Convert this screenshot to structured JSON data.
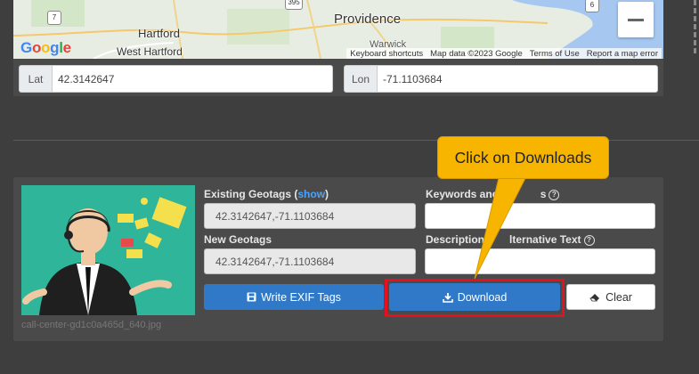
{
  "map": {
    "cities": {
      "providence": "Providence",
      "hartford": "Hartford",
      "west_hartford": "West Hartford",
      "warwick": "Warwick"
    },
    "highways": [
      "7",
      "395",
      "6"
    ],
    "google_logo": [
      "G",
      "o",
      "o",
      "g",
      "l",
      "e"
    ],
    "footer": {
      "keyboard": "Keyboard shortcuts",
      "data": "Map data ©2023 Google",
      "terms": "Terms of Use",
      "report": "Report a map error"
    },
    "zoom_out_icon": "minus-icon"
  },
  "coords": {
    "lat_label": "Lat",
    "lat_value": "42.3142647",
    "lon_label": "Lon",
    "lon_value": "-71.1103684"
  },
  "image": {
    "filename": "call-center-gd1c0a465d_640.jpg",
    "existing_label": "Existing Geotags (",
    "existing_show": "show",
    "existing_close": ")",
    "existing_value": "42.3142647,-71.1103684",
    "new_label": "New Geotags",
    "new_value": "42.3142647,-71.1103684",
    "keywords_label": "Keywords and T",
    "keywords_label_tail": "s",
    "description_label": "Description",
    "description_label_tail": "lternative Text",
    "write_exif_label": "Write EXIF Tags",
    "download_label": "Download",
    "clear_label": "Clear"
  },
  "callout": {
    "text": "Click on Downloads"
  },
  "colors": {
    "accent_blue": "#2f79c8",
    "callout_yellow": "#f7b500",
    "highlight_red": "#e8101e",
    "thumb_teal": "#2fb59a"
  }
}
